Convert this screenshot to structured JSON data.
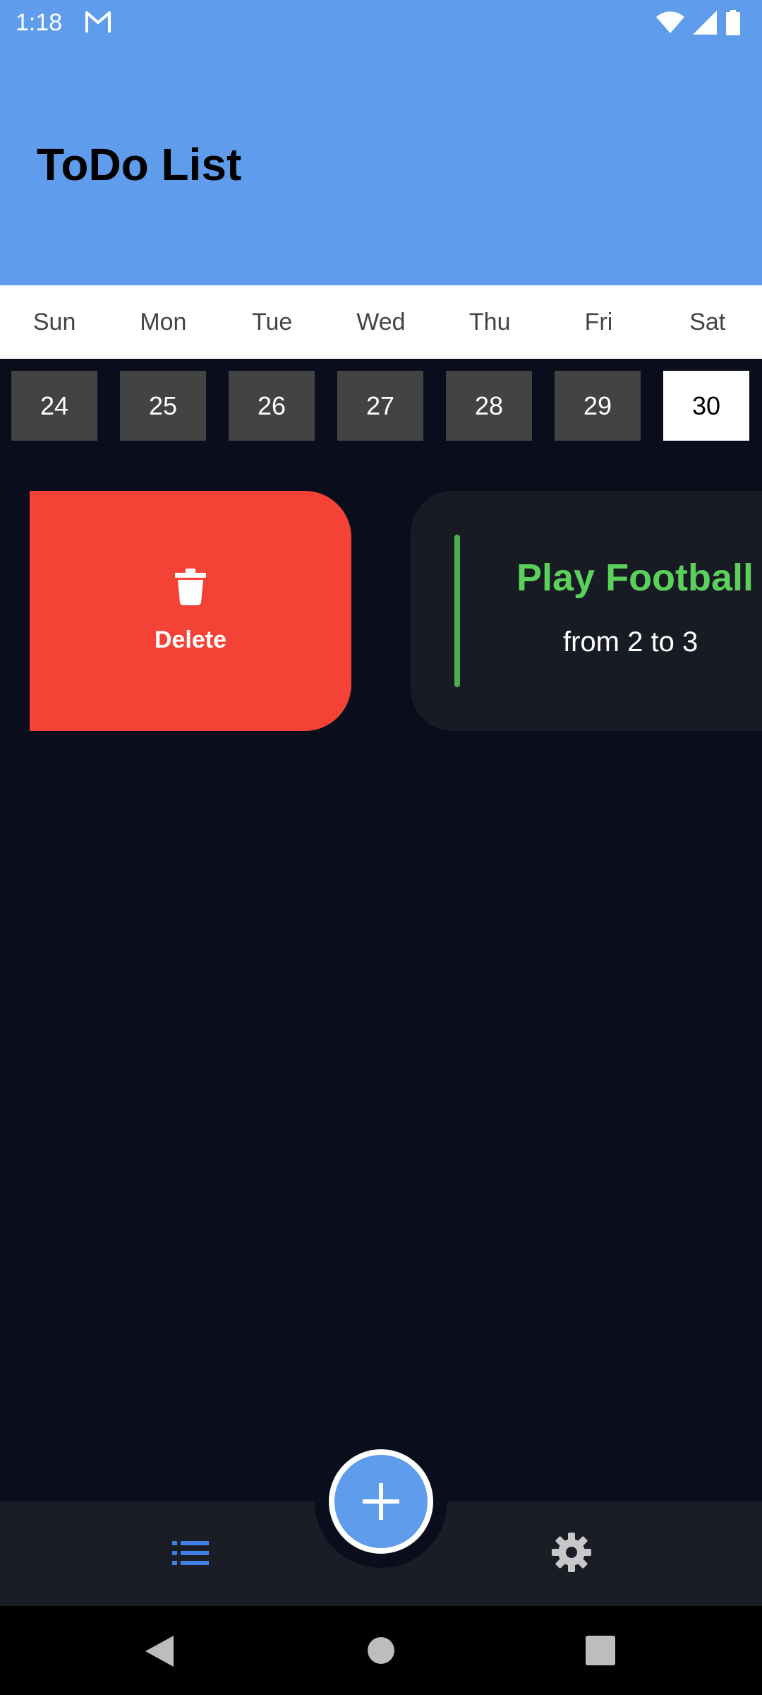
{
  "status_bar": {
    "time": "1:18",
    "icons": [
      "gmail-icon",
      "wifi-icon",
      "signal-icon",
      "battery-icon"
    ]
  },
  "header": {
    "title": "ToDo List",
    "color": "#5f9cec"
  },
  "calendar": {
    "weekdays": [
      "Sun",
      "Mon",
      "Tue",
      "Wed",
      "Thu",
      "Fri",
      "Sat"
    ],
    "dates": [
      "24",
      "25",
      "26",
      "27",
      "28",
      "29",
      "30"
    ],
    "selected_date": "30"
  },
  "tasks": [
    {
      "title": "Play Football",
      "time": "from 2 to 3",
      "color": "#5bd15b",
      "action": {
        "label": "Delete",
        "icon": "trash-icon",
        "color": "#f44336"
      }
    }
  ],
  "bottom_nav": {
    "items": [
      {
        "icon": "list-icon",
        "active": true
      },
      {
        "icon": "add-icon",
        "type": "fab"
      },
      {
        "icon": "gear-icon",
        "active": false
      }
    ],
    "accent": "#5f9cec"
  },
  "system_nav": {
    "icons": [
      "back-icon",
      "home-icon",
      "recents-icon"
    ]
  }
}
